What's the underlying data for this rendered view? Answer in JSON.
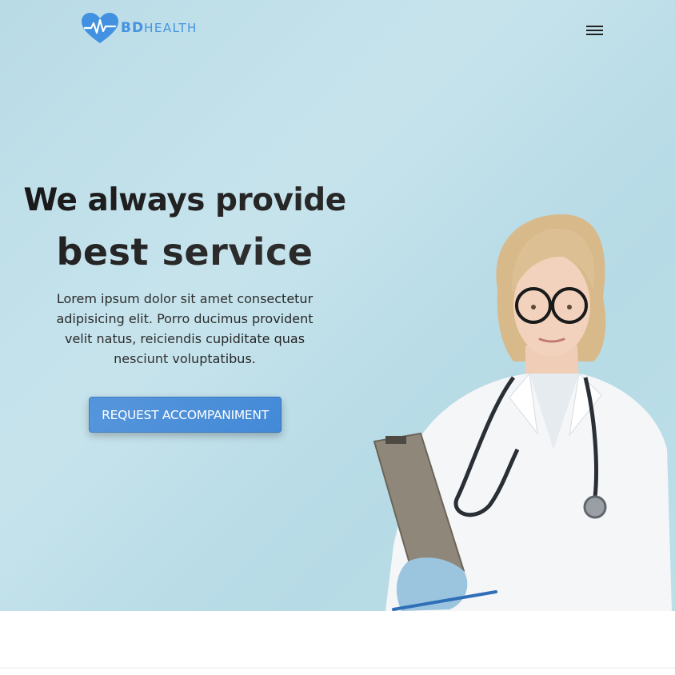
{
  "header": {
    "logo_bold": "BD",
    "logo_rest": "HEALTH",
    "menu_icon": "hamburger-menu-icon"
  },
  "hero": {
    "title_line1": "We always provide",
    "title_line2": "best service",
    "description": "Lorem ipsum dolor sit amet consectetur adipisicing elit. Porro ducimus provident velit natus, reiciendis cupiditate quas nesciunt voluptatibus.",
    "cta_label": "REQUEST ACCOMPANIMENT",
    "image_icon": "doctor-illustration"
  },
  "colors": {
    "brand_blue": "#3c8ee0",
    "hero_bg": "#bcdfe8",
    "button_blue": "#3d86d6"
  }
}
